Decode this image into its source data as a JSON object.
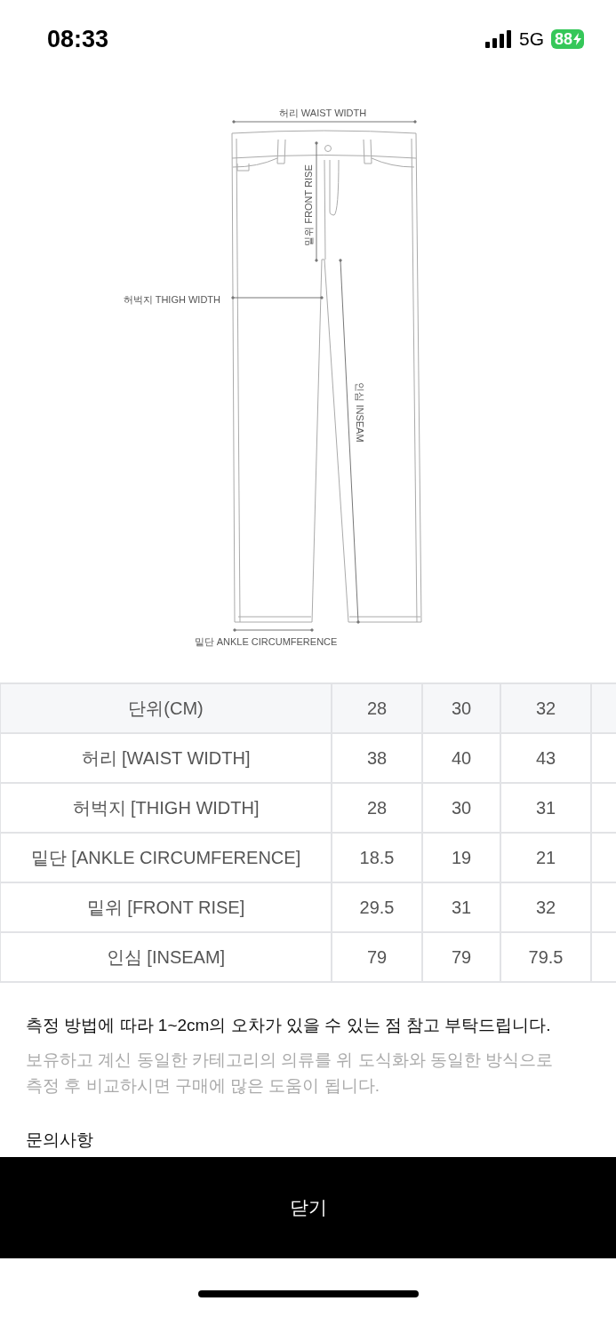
{
  "status_bar": {
    "time": "08:33",
    "network": "5G",
    "battery": "88",
    "charging": true
  },
  "diagram": {
    "waist_label": "허리 WAIST WIDTH",
    "front_rise_label": "밑위 FRONT RISE",
    "thigh_label": "허벅지 THIGH WIDTH",
    "inseam_label": "인심 INSEAM",
    "ankle_label": "밑단 ANKLE CIRCUMFERENCE"
  },
  "size_table": {
    "columns": [
      "단위(CM)",
      "28",
      "30",
      "32"
    ],
    "rows": [
      {
        "label": "허리 [WAIST WIDTH]",
        "values": [
          "38",
          "40",
          "43"
        ]
      },
      {
        "label": "허벅지 [THIGH WIDTH]",
        "values": [
          "28",
          "30",
          "31"
        ]
      },
      {
        "label": "밑단 [ANKLE CIRCUMFERENCE]",
        "values": [
          "18.5",
          "19",
          "21"
        ]
      },
      {
        "label": "밑위 [FRONT RISE]",
        "values": [
          "29.5",
          "31",
          "32"
        ]
      },
      {
        "label": "인심 [INSEAM]",
        "values": [
          "79",
          "79",
          "79.5"
        ]
      }
    ]
  },
  "notes": {
    "notice": "측정 방법에 따라 1~2cm의 오차가 있을 수 있는 점 참고 부탁드립니다.",
    "tip": "보유하고 계신 동일한 카테고리의 의류를 위 도식화와 동일한 방식으로 측정 후 비교하시면 구매에 많은 도움이 됩니다.",
    "inquiry_heading": "문의사항"
  },
  "close_button": "닫기"
}
